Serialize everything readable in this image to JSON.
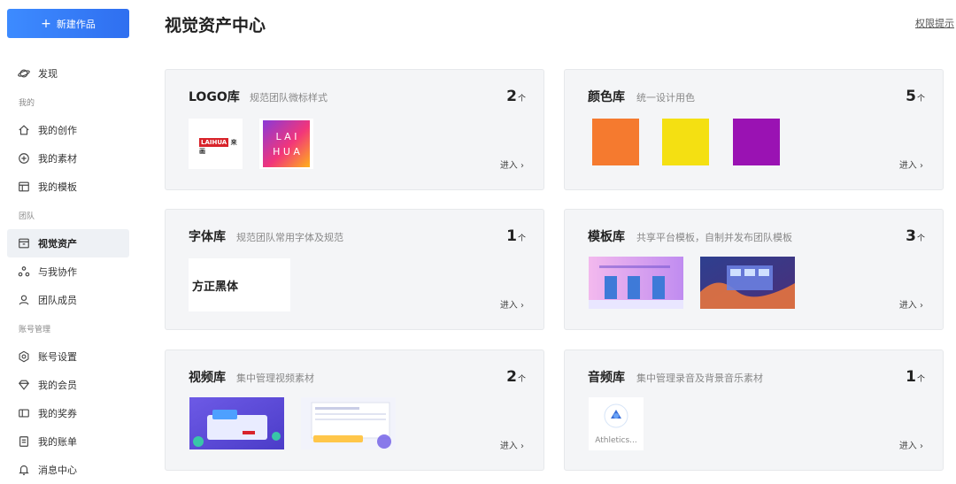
{
  "sidebar": {
    "new_button_label": "新建作品",
    "discover": "发现",
    "section_mine": "我的",
    "my_creations": "我的创作",
    "my_materials": "我的素材",
    "my_templates": "我的模板",
    "section_team": "团队",
    "visual_assets": "视觉资产",
    "collab": "与我协作",
    "team_members": "团队成员",
    "section_account": "账号管理",
    "account_settings": "账号设置",
    "my_membership": "我的会员",
    "my_rewards": "我的奖券",
    "my_bills": "我的账单",
    "messages": "消息中心"
  },
  "header": {
    "title": "视觉资产中心",
    "permission_link": "权限提示"
  },
  "cards": {
    "logo": {
      "title": "LOGO库",
      "desc": "规范团队微标样式",
      "count": "2",
      "unit": "个",
      "enter": "进入 ›"
    },
    "color": {
      "title": "颜色库",
      "desc": "统一设计用色",
      "count": "5",
      "unit": "个",
      "enter": "进入 ›",
      "swatches": [
        "#f57a2f",
        "#f4e012",
        "#9a12b3"
      ]
    },
    "font": {
      "title": "字体库",
      "desc": "规范团队常用字体及规范",
      "count": "1",
      "unit": "个",
      "enter": "进入 ›",
      "font_sample": "方正黑体"
    },
    "template": {
      "title": "模板库",
      "desc": "共享平台模板，自制并发布团队模板",
      "count": "3",
      "unit": "个",
      "enter": "进入 ›"
    },
    "video": {
      "title": "视频库",
      "desc": "集中管理视频素材",
      "count": "2",
      "unit": "个",
      "enter": "进入 ›"
    },
    "audio": {
      "title": "音频库",
      "desc": "集中管理录音及背景音乐素材",
      "count": "1",
      "unit": "个",
      "enter": "进入 ›",
      "audio_name": "Athletics..."
    }
  },
  "logos": {
    "laihua_tag": "LAIHUA",
    "laihua_cn": "来画",
    "laihua_big": [
      "L A I",
      "H U A"
    ]
  }
}
